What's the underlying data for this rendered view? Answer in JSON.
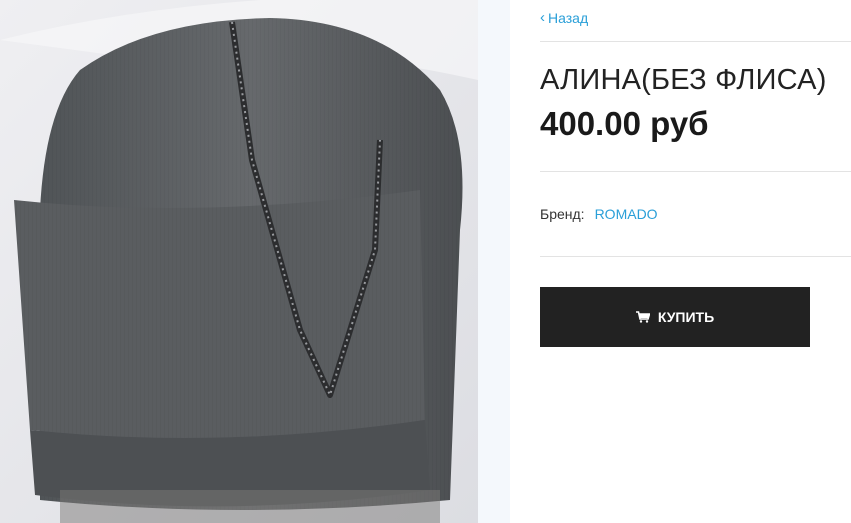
{
  "product_image": {
    "icon": "hat-photo",
    "alt_subject": "grey knitted hat with rhinestone trim"
  },
  "navigation": {
    "back_label": "Назад",
    "back_icon": "chevron-left-icon"
  },
  "product": {
    "title": "АЛИНА(БЕЗ ФЛИСА)",
    "price": "400.00 руб"
  },
  "brand": {
    "label": "Бренд:",
    "value": "ROMADO"
  },
  "actions": {
    "buy_label": "КУПИТЬ",
    "buy_icon": "cart-icon"
  },
  "colors": {
    "accent": "#2a9fd8",
    "button": "#222222"
  }
}
